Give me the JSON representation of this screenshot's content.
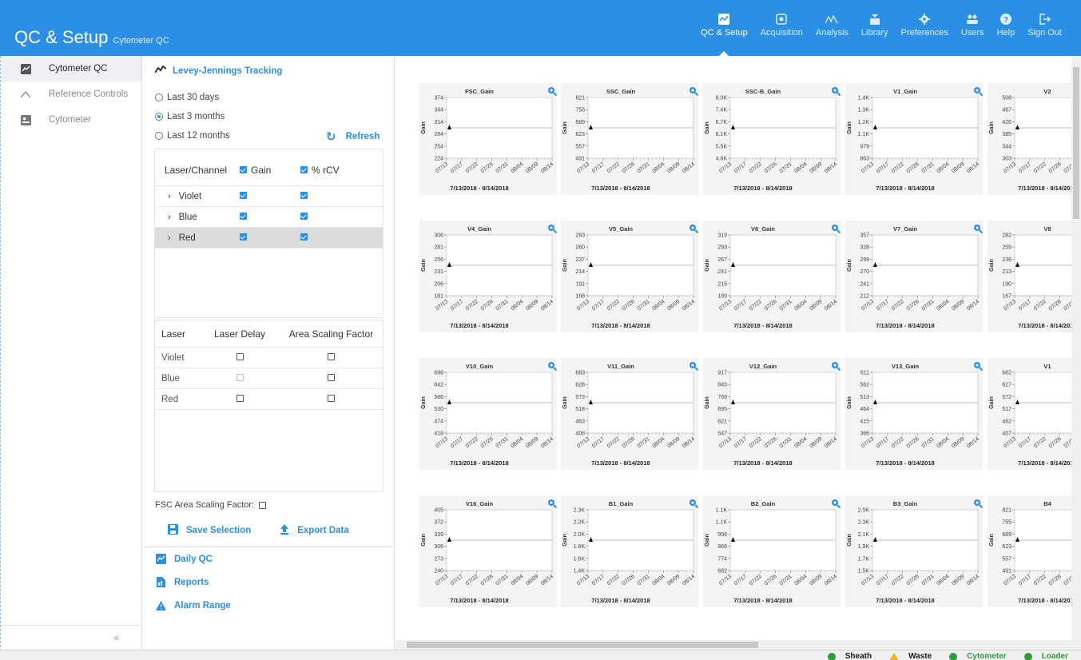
{
  "header": {
    "title": "QC & Setup",
    "subtitle": "Cytometer QC",
    "nav": [
      {
        "label": "QC & Setup",
        "icon": "qc-setup-icon",
        "active": true
      },
      {
        "label": "Acquisition",
        "icon": "acquisition-icon",
        "active": false
      },
      {
        "label": "Analysis",
        "icon": "analysis-icon",
        "active": false
      },
      {
        "label": "Library",
        "icon": "library-icon",
        "active": false
      },
      {
        "label": "Preferences",
        "icon": "gear-icon",
        "active": false
      },
      {
        "label": "Users",
        "icon": "users-icon",
        "active": false
      },
      {
        "label": "Help",
        "icon": "help-icon",
        "active": false
      },
      {
        "label": "Sign Out",
        "icon": "sign-out-icon",
        "active": false
      }
    ]
  },
  "sidebar": {
    "items": [
      {
        "label": "Cytometer QC",
        "icon": "cytometer-qc-icon",
        "active": true
      },
      {
        "label": "Reference Controls",
        "icon": "reference-controls-icon",
        "active": false
      },
      {
        "label": "Cytometer",
        "icon": "cytometer-icon",
        "active": false
      }
    ],
    "collapse_label": "«"
  },
  "panel": {
    "heading": "Levey-Jennings Tracking",
    "ranges": [
      {
        "label": "Last 30 days",
        "selected": false
      },
      {
        "label": "Last 3 months",
        "selected": true
      },
      {
        "label": "Last 12 months",
        "selected": false
      }
    ],
    "refresh_label": "Refresh",
    "channel_table": {
      "col_laser": "Laser/Channel",
      "col_gain": "Gain",
      "col_rcv": "% rCV",
      "rows": [
        {
          "label": "Violet",
          "gain": true,
          "rcv": true,
          "selected": false
        },
        {
          "label": "Blue",
          "gain": true,
          "rcv": true,
          "selected": false
        },
        {
          "label": "Red",
          "gain": true,
          "rcv": true,
          "selected": true
        }
      ]
    },
    "laser_table": {
      "col_laser": "Laser",
      "col_delay": "Laser Delay",
      "col_asf": "Area Scaling Factor",
      "rows": [
        {
          "label": "Violet",
          "delay": false,
          "asf": false,
          "delay_disabled": false
        },
        {
          "label": "Blue",
          "delay": false,
          "asf": false,
          "delay_disabled": true
        },
        {
          "label": "Red",
          "delay": false,
          "asf": false,
          "delay_disabled": false
        }
      ]
    },
    "fsc_label": "FSC Area Scaling Factor:",
    "save_label": "Save Selection",
    "export_label": "Export Data",
    "sections": [
      {
        "label": "Daily QC",
        "icon": "daily-qc-icon"
      },
      {
        "label": "Reports",
        "icon": "reports-icon"
      },
      {
        "label": "Alarm Range",
        "icon": "alarm-icon"
      }
    ]
  },
  "charts": {
    "ylabel": "Gain",
    "date_range": "7/13/2018 - 8/14/2018",
    "x_ticks": [
      "07/13",
      "07/17",
      "07/22",
      "07/26",
      "07/31",
      "08/04",
      "08/09",
      "08/14"
    ],
    "rows": [
      [
        {
          "title": "FSC_Gain",
          "ticks": [
            "374",
            "344",
            "314",
            "284",
            "254",
            "224"
          ],
          "value_index": 2.5
        },
        {
          "title": "SSC_Gain",
          "ticks": [
            "821",
            "755",
            "689",
            "623",
            "557",
            "491"
          ],
          "value_index": 2.5
        },
        {
          "title": "SSC-B_Gain",
          "ticks": [
            "8.0K",
            "7.4K",
            "6.7K",
            "6.1K",
            "5.5K",
            "4.8K"
          ],
          "value_index": 2.5
        },
        {
          "title": "V1_Gain",
          "ticks": [
            "1.4K",
            "1.3K",
            "1.2K",
            "1.1K",
            "979",
            "863"
          ],
          "value_index": 2.5
        },
        {
          "title": "V2",
          "ticks": [
            "508",
            "467",
            "426",
            "385",
            "344",
            "303"
          ],
          "value_index": 2.5
        }
      ],
      [
        {
          "title": "V4_Gain",
          "ticks": [
            "306",
            "281",
            "256",
            "231",
            "206",
            "181"
          ],
          "value_index": 2.5
        },
        {
          "title": "V5_Gain",
          "ticks": [
            "283",
            "260",
            "237",
            "214",
            "191",
            "168"
          ],
          "value_index": 2.5
        },
        {
          "title": "V6_Gain",
          "ticks": [
            "319",
            "293",
            "267",
            "241",
            "215",
            "189"
          ],
          "value_index": 2.5
        },
        {
          "title": "V7_Gain",
          "ticks": [
            "357",
            "328",
            "299",
            "270",
            "241",
            "212"
          ],
          "value_index": 2.5
        },
        {
          "title": "V8",
          "ticks": [
            "282",
            "259",
            "236",
            "213",
            "190",
            "167"
          ],
          "value_index": 2.5
        }
      ],
      [
        {
          "title": "V10_Gain",
          "ticks": [
            "698",
            "642",
            "586",
            "530",
            "474",
            "418"
          ],
          "value_index": 2.5
        },
        {
          "title": "V11_Gain",
          "ticks": [
            "683",
            "628",
            "573",
            "518",
            "463",
            "408"
          ],
          "value_index": 2.5
        },
        {
          "title": "V12_Gain",
          "ticks": [
            "917",
            "843",
            "769",
            "695",
            "621",
            "547"
          ],
          "value_index": 2.5
        },
        {
          "title": "V13_Gain",
          "ticks": [
            "611",
            "562",
            "513",
            "464",
            "415",
            "366"
          ],
          "value_index": 2.5
        },
        {
          "title": "V1",
          "ticks": [
            "682",
            "627",
            "572",
            "517",
            "462",
            "407"
          ],
          "value_index": 2.5
        }
      ],
      [
        {
          "title": "V16_Gain",
          "ticks": [
            "405",
            "372",
            "339",
            "306",
            "273",
            "240"
          ],
          "value_index": 2.5
        },
        {
          "title": "B1_Gain",
          "ticks": [
            "2.3K",
            "2.2K",
            "2.0K",
            "1.8K",
            "1.6K",
            "1.4K"
          ],
          "value_index": 2.5
        },
        {
          "title": "B2_Gain",
          "ticks": [
            "1.1K",
            "1.1K",
            "958",
            "866",
            "774",
            "682"
          ],
          "value_index": 2.5
        },
        {
          "title": "B3_Gain",
          "ticks": [
            "2.5K",
            "2.3K",
            "2.1K",
            "1.9K",
            "1.7K",
            "1.5K"
          ],
          "value_index": 2.5
        },
        {
          "title": "B4",
          "ticks": [
            "821",
            "755",
            "689",
            "623",
            "557",
            "491"
          ],
          "value_index": 2.5
        }
      ]
    ]
  },
  "status": [
    {
      "label": "Sheath",
      "kind": "ok",
      "color": "#1a1a1a"
    },
    {
      "label": "Waste",
      "kind": "warn",
      "color": "#1a1a1a"
    },
    {
      "label": "Cytometer",
      "kind": "ok",
      "color": "#2e9e3a"
    },
    {
      "label": "Loader",
      "kind": "ok",
      "color": "#2e9e3a"
    }
  ],
  "colors": {
    "accent": "#2b8fe6",
    "ok": "#2e9e3a",
    "warn": "#e5b82a"
  }
}
